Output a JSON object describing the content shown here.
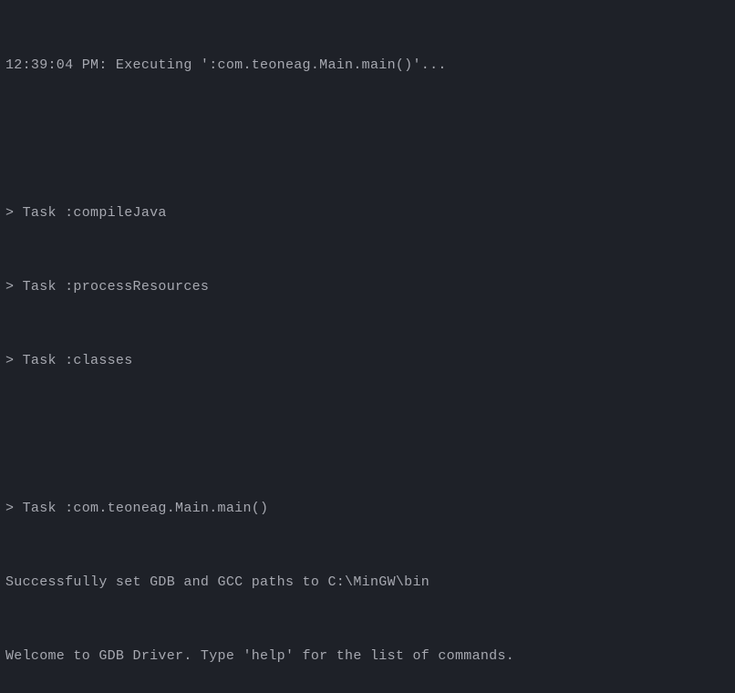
{
  "console": {
    "lines": [
      "12:39:04 PM: Executing ':com.teoneag.Main.main()'...",
      "",
      "> Task :compileJava",
      "> Task :processResources",
      "> Task :classes",
      "",
      "> Task :com.teoneag.Main.main()",
      "Successfully set GDB and GCC paths to C:\\MinGW\\bin",
      "Welcome to GDB Driver. Type 'help' for the list of commands."
    ]
  }
}
